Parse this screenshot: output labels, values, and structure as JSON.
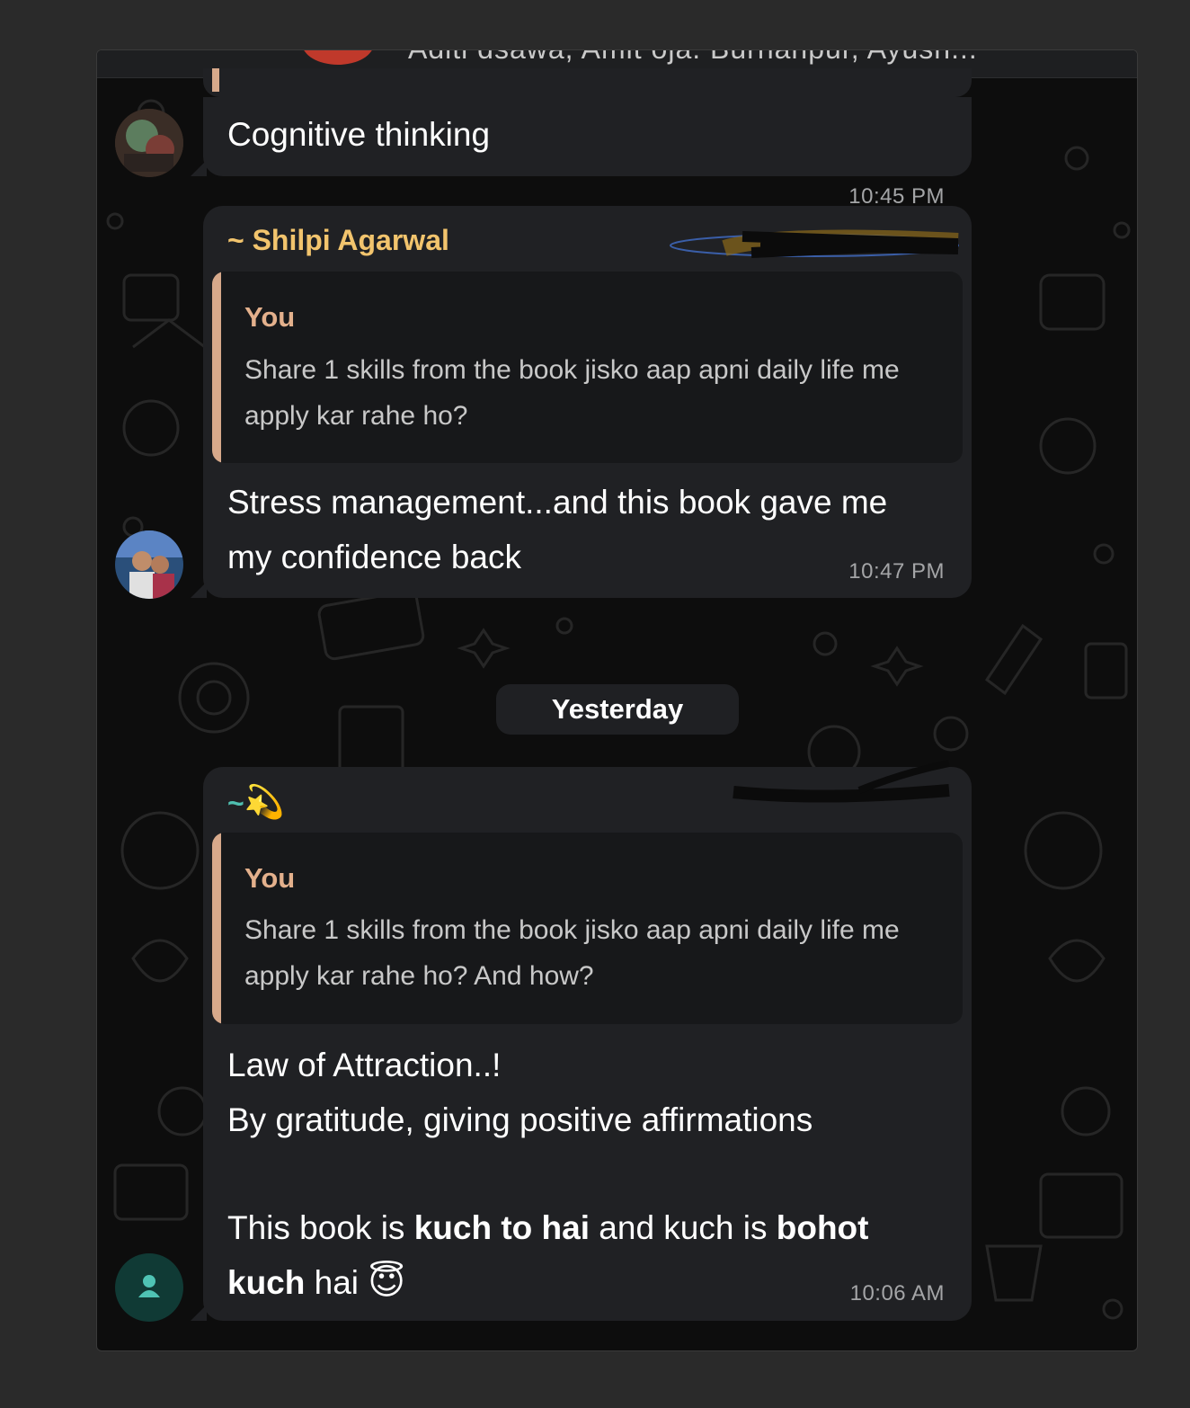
{
  "header": {
    "members_text": "Aditi dsawa, Amit oja. Burhanpur, Ayush..."
  },
  "messages": [
    {
      "text": "Cognitive thinking",
      "time": "10:45 PM"
    },
    {
      "sender": "~ Shilpi Agarwal",
      "sender_color": "#f2c46d",
      "quote_author": "You",
      "quote_text": "Share 1 skills from the book jisko aap apni daily life me apply kar rahe ho?",
      "text_line1": "Stress management...and this book gave me",
      "text_line2": "my confidence back",
      "time": "10:47 PM"
    },
    {
      "sender_prefix": "~",
      "sender_emoji": "💫",
      "sender_color": "#4fbfb0",
      "quote_author": "You",
      "quote_text": "Share 1 skills from the book jisko aap apni daily life me apply kar rahe ho? And how?",
      "line1": "Law of Attraction..!",
      "line2": "By gratitude, giving positive affirmations",
      "line3_a": "This book is ",
      "line3_b": "kuch to hai",
      "line3_c": " and kuch is ",
      "line3_d": "bohot",
      "line4_a": "kuch",
      "line4_b": " hai ",
      "line4_emoji": "😇",
      "time": "10:06 AM"
    }
  ],
  "date_divider": "Yesterday",
  "icons": {
    "default_avatar": "person-icon"
  },
  "colors": {
    "bubble": "#202124",
    "quote_bg": "#17181a",
    "quote_bar": "#d7a98b",
    "quote_author": "#e3b08c",
    "background": "#0d0d0d",
    "default_avatar_bg": "#103a35",
    "default_avatar_fg": "#4fc3b4"
  }
}
